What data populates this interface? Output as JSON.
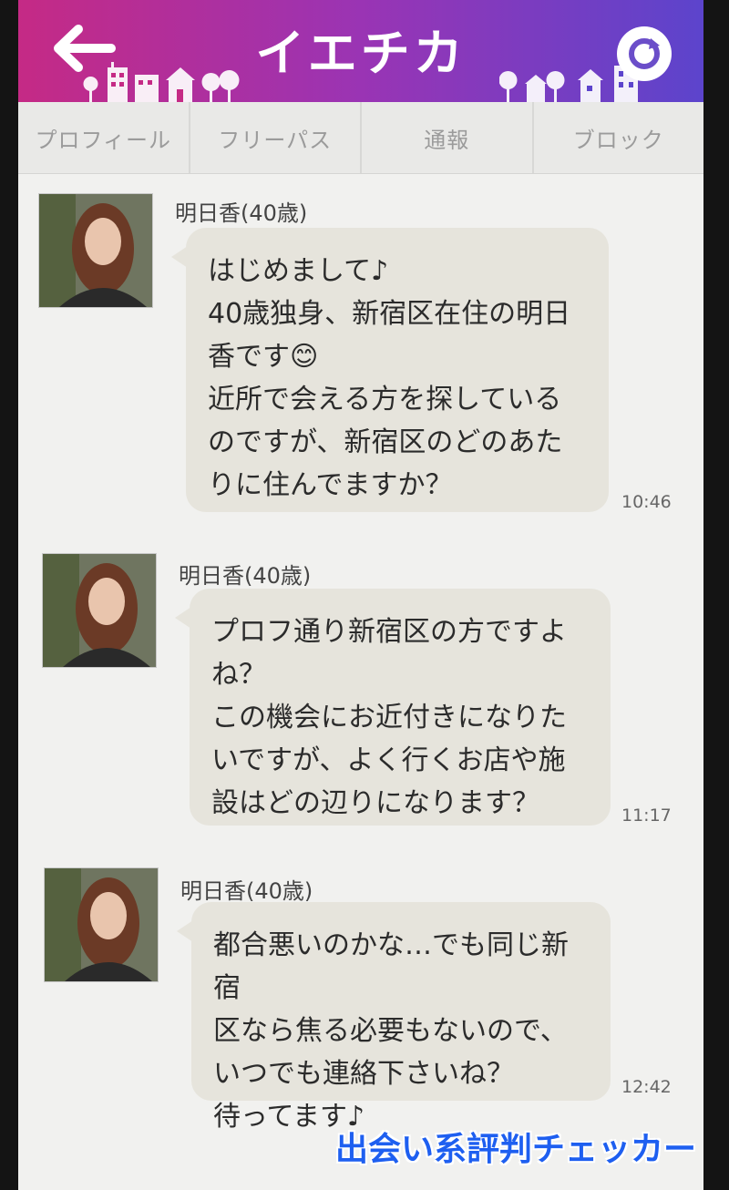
{
  "header": {
    "title": "イエチカ",
    "back_icon": "arrow-left-icon",
    "refresh_icon": "refresh-icon",
    "gradient": [
      "#c52a85",
      "#9a34b4",
      "#5c44cc"
    ]
  },
  "tabs": [
    {
      "label": "プロフィール"
    },
    {
      "label": "フリーパス"
    },
    {
      "label": "通報"
    },
    {
      "label": "ブロック"
    }
  ],
  "messages": [
    {
      "sender": "明日香(40歳)",
      "text": "はじめまして♪\n40歳独身、新宿区在住の明日\n香です😊\n近所で会える方を探している\nのですが、新宿区のどのあた\nりに住んでますか？",
      "time": "10:46"
    },
    {
      "sender": "明日香(40歳)",
      "text": "プロフ通り新宿区の方ですよ\nね？\nこの機会にお近付きになりた\nいですが、よく行くお店や施\n設はどの辺りになります？",
      "time": "11:17"
    },
    {
      "sender": "明日香(40歳)",
      "text": "都合悪いのかな…でも同じ新宿\n区なら焦る必要もないので、\nいつでも連絡下さいね？\n待ってます♪",
      "time": "12:42"
    }
  ],
  "watermark": "出会い系評判チェッカー",
  "colors": {
    "bubble": "#e6e4dc",
    "background": "#f1f1ef",
    "watermark": "#1e5ff0"
  }
}
